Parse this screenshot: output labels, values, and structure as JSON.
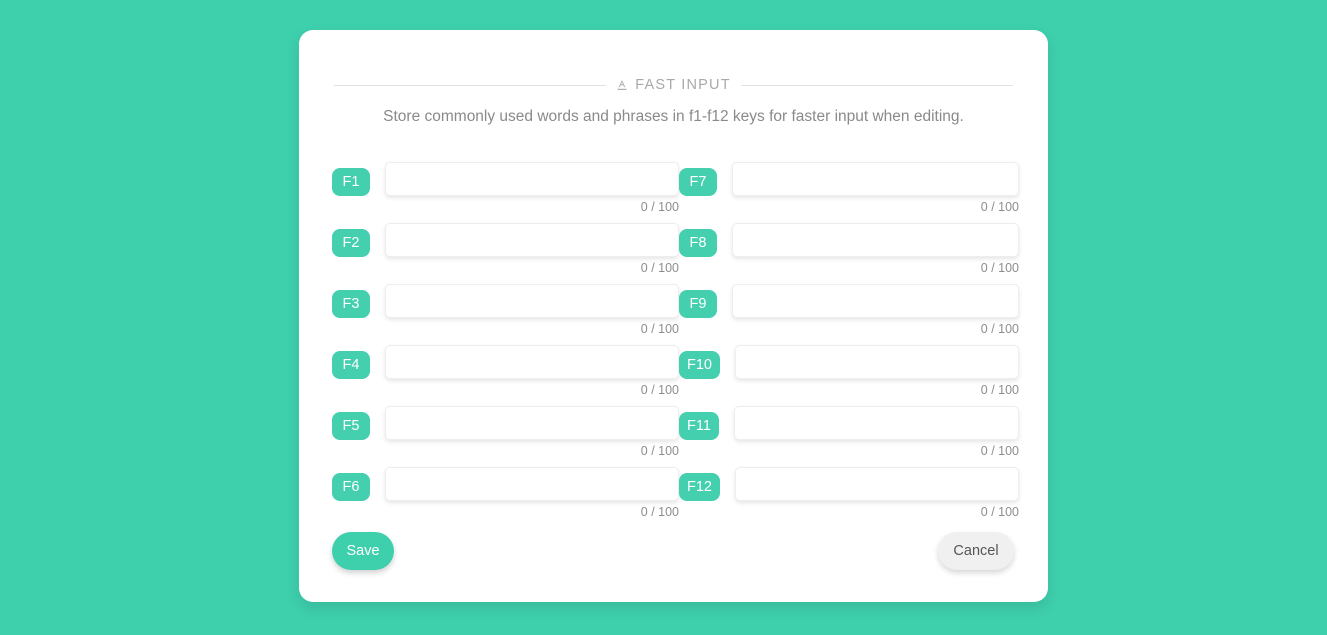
{
  "theme": {
    "background": "#3ECFAD",
    "accent": "#3ECFAD",
    "badge": "#44cfaf",
    "card": "#ffffff",
    "muted_text": "#8a8a8a",
    "counter_text": "#8d8d8d",
    "cancel_bg": "#f0f0f0"
  },
  "header": {
    "icon": "text-format-icon",
    "title": "FAST INPUT"
  },
  "description": "Store commonly used words and phrases in f1-f12 keys for faster input when editing.",
  "rows": [
    {
      "key": "F1",
      "value": "",
      "placeholder": "",
      "counter": "0 / 100"
    },
    {
      "key": "F2",
      "value": "",
      "placeholder": "",
      "counter": "0 / 100"
    },
    {
      "key": "F3",
      "value": "",
      "placeholder": "",
      "counter": "0 / 100"
    },
    {
      "key": "F4",
      "value": "",
      "placeholder": "",
      "counter": "0 / 100"
    },
    {
      "key": "F5",
      "value": "",
      "placeholder": "",
      "counter": "0 / 100"
    },
    {
      "key": "F6",
      "value": "",
      "placeholder": "",
      "counter": "0 / 100"
    },
    {
      "key": "F7",
      "value": "",
      "placeholder": "",
      "counter": "0 / 100"
    },
    {
      "key": "F8",
      "value": "",
      "placeholder": "",
      "counter": "0 / 100"
    },
    {
      "key": "F9",
      "value": "",
      "placeholder": "",
      "counter": "0 / 100"
    },
    {
      "key": "F10",
      "value": "",
      "placeholder": "",
      "counter": "0 / 100"
    },
    {
      "key": "F11",
      "value": "",
      "placeholder": "",
      "counter": "0 / 100"
    },
    {
      "key": "F12",
      "value": "",
      "placeholder": "",
      "counter": "0 / 100"
    }
  ],
  "footer": {
    "save_label": "Save",
    "cancel_label": "Cancel"
  }
}
